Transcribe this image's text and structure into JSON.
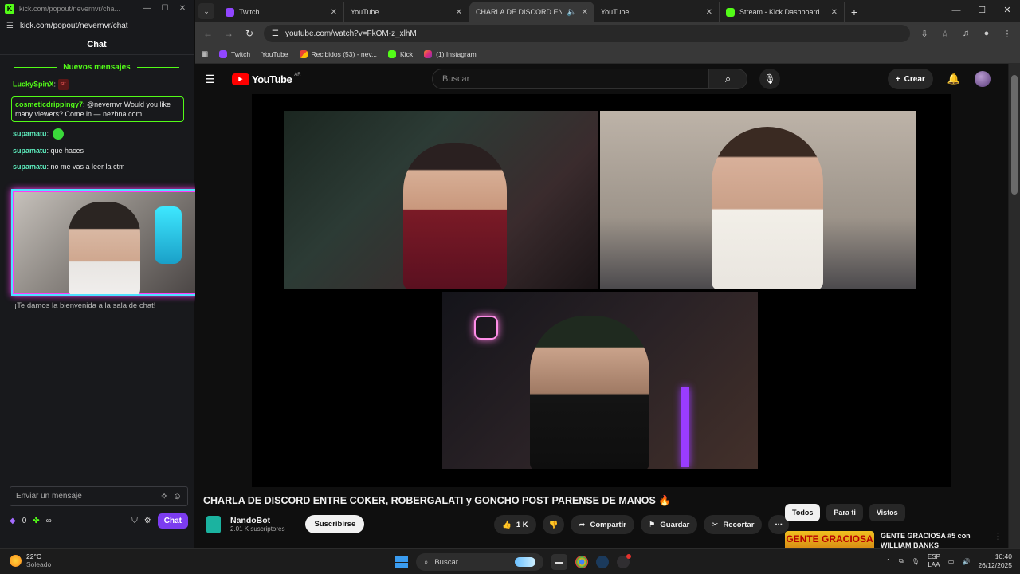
{
  "kick": {
    "window_title": "kick.com/popout/nevernvr/cha...",
    "url": "kick.com/popout/nevernvr/chat",
    "chat_header": "Chat",
    "new_messages": "Nuevos mensajes",
    "messages": [
      {
        "user": "LuckySpinX",
        "text": ":",
        "emote": "sit"
      },
      {
        "user": "cosmeticdrippingy7",
        "text": ": @nevernvr Would you like many viewers? Come in — nezhna.com"
      },
      {
        "user": "supamatu",
        "text": ":"
      },
      {
        "user": "supamatu",
        "text": ": que haces"
      },
      {
        "user": "supamatu",
        "text": ": no me vas a leer la ctm"
      }
    ],
    "welcome": "¡Te damos la bienvenida a la sala de chat!",
    "input_placeholder": "Enviar un mensaje",
    "points": "0",
    "infinity": "∞",
    "chat_button": "Chat"
  },
  "chrome": {
    "tabs": [
      {
        "title": "Twitch",
        "icon": "twitch"
      },
      {
        "title": "YouTube",
        "icon": "youtube"
      },
      {
        "title": "CHARLA DE DISCORD ENTR",
        "icon": "youtube",
        "active": true
      },
      {
        "title": "YouTube",
        "icon": "youtube"
      },
      {
        "title": "Stream - Kick Dashboard",
        "icon": "kick"
      }
    ],
    "url": "youtube.com/watch?v=FkOM-z_xlhM",
    "bookmarks": [
      {
        "label": "Twitch",
        "icon": "twitch"
      },
      {
        "label": "YouTube",
        "icon": "youtube"
      },
      {
        "label": "Recibidos (53) - nev...",
        "icon": "gmail"
      },
      {
        "label": "Kick",
        "icon": "kick"
      },
      {
        "label": "(1) Instagram",
        "icon": "instagram"
      }
    ]
  },
  "youtube": {
    "logo": "YouTube",
    "country": "AR",
    "search_placeholder": "Buscar",
    "create_label": "Crear",
    "video_title": "CHARLA DE DISCORD ENTRE COKER, ROBERGALATI y GONCHO POST PARENSE DE MANOS",
    "channel_name": "NandoBot",
    "channel_subs": "2.01 K suscriptores",
    "subscribe": "Suscribirse",
    "likes": "1 K",
    "share": "Compartir",
    "save": "Guardar",
    "clip": "Recortar",
    "chips": [
      "Todos",
      "Para ti",
      "Vistos"
    ],
    "rec_thumb_text": "GENTE GRACIOSA",
    "rec_title": "GENTE GRACIOSA #5 con WILLIAM BANKS"
  },
  "taskbar": {
    "temp": "22°C",
    "weather": "Soleado",
    "search": "Buscar",
    "lang1": "ESP",
    "lang2": "LAA",
    "time": "10:40",
    "date": "26/12/2025"
  }
}
